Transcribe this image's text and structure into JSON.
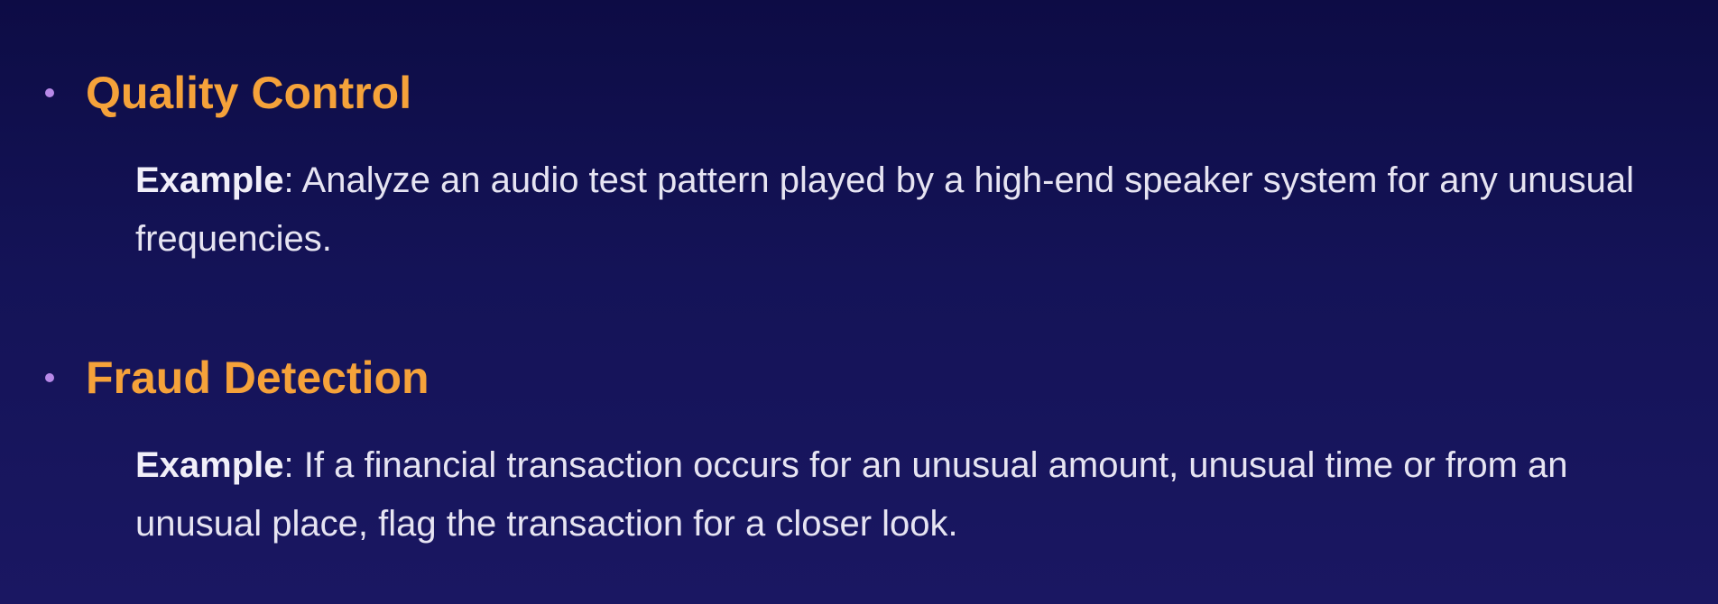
{
  "items": [
    {
      "title": "Quality Control",
      "example_label": "Example",
      "example_text": ": Analyze an audio test pattern played by a high-end speaker system for any unusual frequencies."
    },
    {
      "title": "Fraud Detection",
      "example_label": "Example",
      "example_text": ": If a financial transaction occurs for an unusual amount, unusual time or from an unusual place, flag the transaction for a closer look."
    }
  ],
  "colors": {
    "heading": "#f5a23a",
    "bullet": "#b889e8",
    "body_text": "#e6e4f2",
    "background_top": "#0d0c45",
    "background_bottom": "#1a1762"
  }
}
